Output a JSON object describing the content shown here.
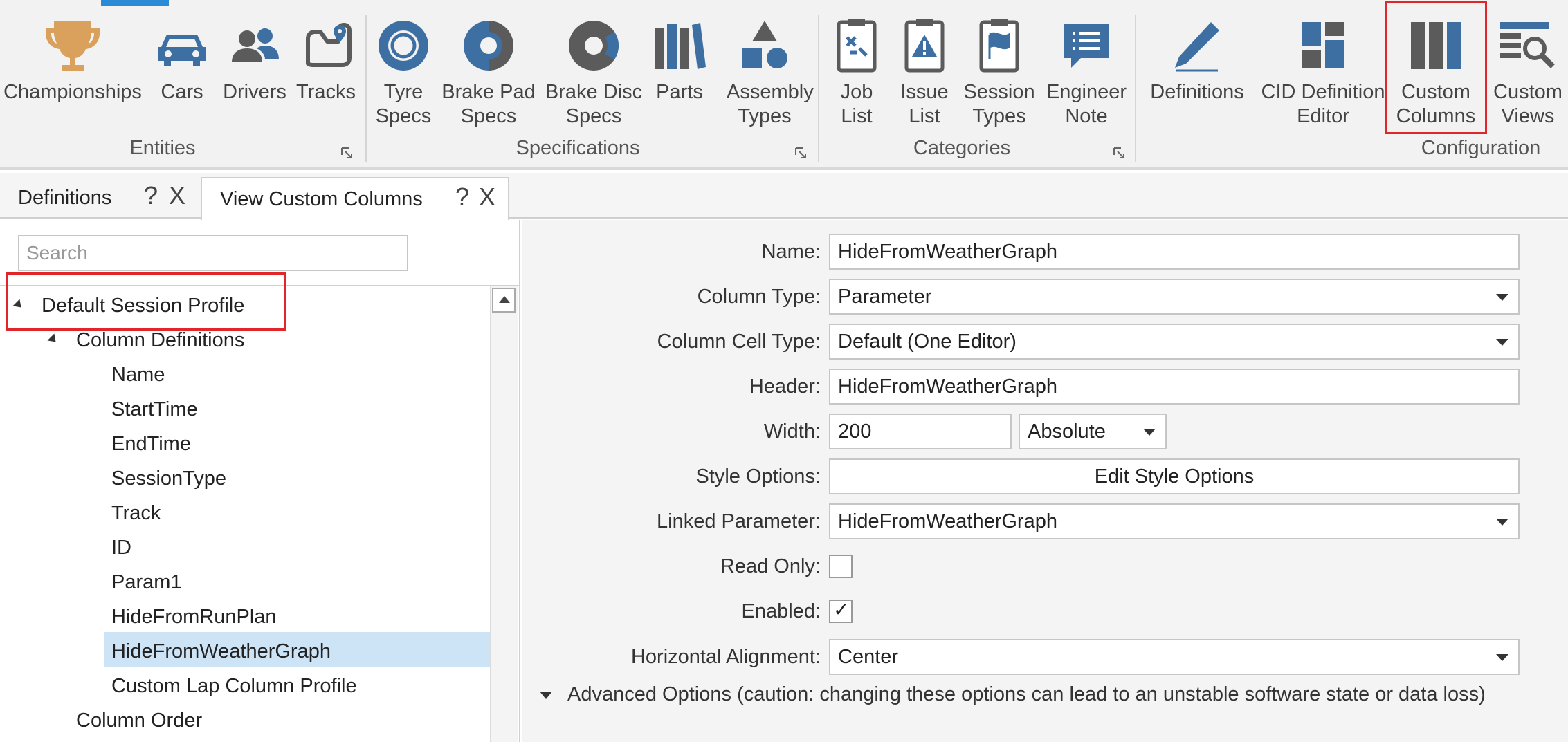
{
  "ribbon": {
    "groups": {
      "entities": {
        "label": "Entities",
        "buttons": [
          {
            "label": "Championships",
            "icon": "trophy-icon"
          },
          {
            "label": "Cars",
            "icon": "car-icon"
          },
          {
            "label": "Drivers",
            "icon": "drivers-icon"
          },
          {
            "label": "Tracks",
            "icon": "track-map-icon"
          }
        ]
      },
      "specifications": {
        "label": "Specifications",
        "buttons": [
          {
            "label": "Tyre\nSpecs",
            "icon": "tyre-icon"
          },
          {
            "label": "Brake Pad\nSpecs",
            "icon": "brake-pad-icon"
          },
          {
            "label": "Brake Disc\nSpecs",
            "icon": "brake-disc-icon"
          },
          {
            "label": "Parts",
            "icon": "parts-icon"
          },
          {
            "label": "Assembly\nTypes",
            "icon": "assembly-shapes-icon"
          }
        ]
      },
      "categories": {
        "label": "Categories",
        "buttons": [
          {
            "label": "Job\nList",
            "icon": "job-list-icon"
          },
          {
            "label": "Issue\nList",
            "icon": "issue-list-icon"
          },
          {
            "label": "Session\nTypes",
            "icon": "session-types-icon"
          },
          {
            "label": "Engineer\nNote",
            "icon": "engineer-note-icon"
          }
        ]
      },
      "configuration": {
        "label": "Configuration",
        "buttons": [
          {
            "label": "Definitions",
            "icon": "pencil-icon"
          },
          {
            "label": "CID Definition\nEditor",
            "icon": "layout-grid-icon"
          },
          {
            "label": "Custom\nColumns",
            "icon": "columns-icon"
          },
          {
            "label": "Custom\nViews",
            "icon": "custom-views-icon"
          }
        ]
      }
    }
  },
  "tabs": [
    {
      "label": "Definitions",
      "help": "?",
      "close": "X"
    },
    {
      "label": "View Custom Columns",
      "help": "?",
      "close": "X"
    }
  ],
  "tree": {
    "search_placeholder": "Search",
    "root": "Default Session Profile",
    "column_definitions": "Column Definitions",
    "items": [
      "Name",
      "StartTime",
      "EndTime",
      "SessionType",
      "Track",
      "ID",
      "Param1",
      "HideFromRunPlan",
      "HideFromWeatherGraph",
      "Custom Lap Column Profile"
    ],
    "selected": "HideFromWeatherGraph",
    "column_order": "Column Order"
  },
  "form": {
    "name": {
      "label": "Name:",
      "value": "HideFromWeatherGraph"
    },
    "column_type": {
      "label": "Column Type:",
      "value": "Parameter"
    },
    "column_cell_type": {
      "label": "Column Cell Type:",
      "value": "Default (One Editor)"
    },
    "header": {
      "label": "Header:",
      "value": "HideFromWeatherGraph"
    },
    "width": {
      "label": "Width:",
      "value": "200",
      "unit": "Absolute"
    },
    "style_options": {
      "label": "Style Options:",
      "button": "Edit Style Options"
    },
    "linked_parameter": {
      "label": "Linked Parameter:",
      "value": "HideFromWeatherGraph"
    },
    "read_only": {
      "label": "Read Only:",
      "checked": false
    },
    "enabled": {
      "label": "Enabled:",
      "checked": true,
      "mark": "✓"
    },
    "horizontal_alignment": {
      "label": "Horizontal Alignment:",
      "value": "Center"
    },
    "advanced_options": "Advanced Options (caution: changing these options can lead to an unstable software state or data loss)"
  },
  "colors": {
    "icon_blue": "#3d6fa3",
    "icon_gray": "#5b5b5b",
    "trophy_gold": "#d9a15c",
    "highlight_red": "#e0262b",
    "selection_blue": "#cde4f7",
    "accent_blue": "#2b8ad6"
  }
}
